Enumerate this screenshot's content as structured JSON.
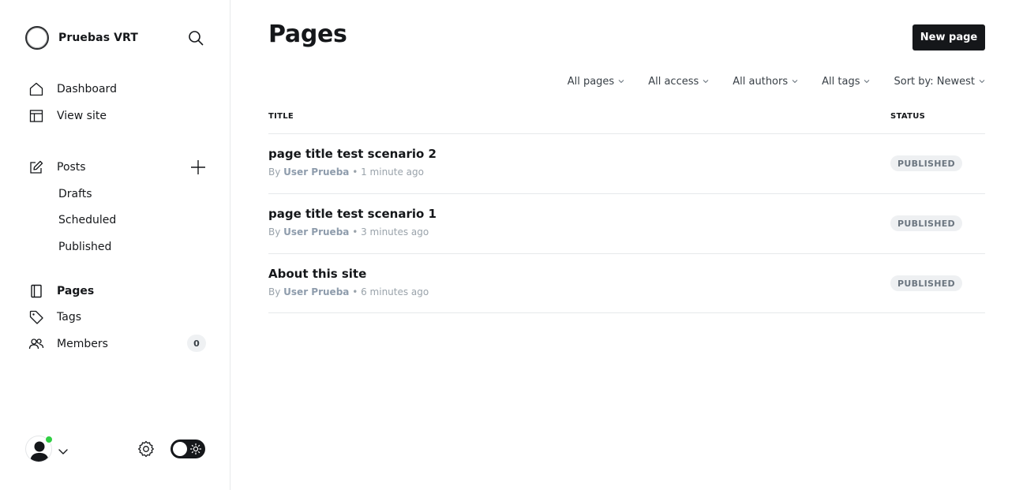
{
  "sidebar": {
    "site_name": "Pruebas VRT",
    "nav": {
      "dashboard": "Dashboard",
      "view_site": "View site",
      "posts": "Posts",
      "drafts": "Drafts",
      "scheduled": "Scheduled",
      "published": "Published",
      "pages": "Pages",
      "tags": "Tags",
      "members": "Members",
      "members_count": "0"
    }
  },
  "header": {
    "title": "Pages",
    "new_button": "New page"
  },
  "filters": [
    "All pages",
    "All access",
    "All authors",
    "All tags",
    "Sort by: Newest"
  ],
  "table": {
    "headers": {
      "title": "TITLE",
      "status": "STATUS"
    },
    "rows": [
      {
        "title": "page title test scenario 2",
        "by": "By",
        "author": "User Prueba",
        "time": "• 1 minute ago",
        "status": "PUBLISHED"
      },
      {
        "title": "page title test scenario 1",
        "by": "By",
        "author": "User Prueba",
        "time": "• 3 minutes ago",
        "status": "PUBLISHED"
      },
      {
        "title": "About this site",
        "by": "By",
        "author": "User Prueba",
        "time": "• 6 minutes ago",
        "status": "PUBLISHED"
      }
    ]
  },
  "colors": {
    "accent_dark": "#15171a",
    "online": "#30cf43",
    "muted_text": "#9aa3ab"
  },
  "icons": [
    "site-logo",
    "search-icon",
    "home-icon",
    "layout-icon",
    "edit-icon",
    "plus-icon",
    "page-icon",
    "tag-icon",
    "members-icon",
    "user-avatar-icon",
    "chevron-down-icon",
    "gear-icon",
    "sun-icon"
  ]
}
